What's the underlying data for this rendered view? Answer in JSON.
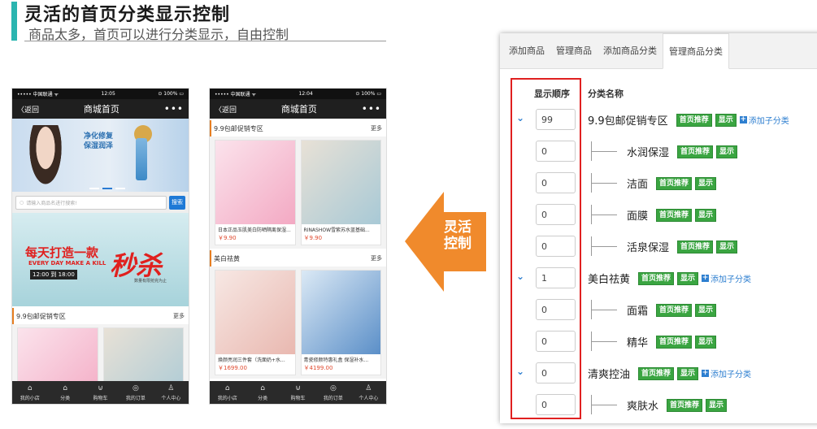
{
  "header": {
    "title": "灵活的首页分类显示控制",
    "subtitle": "商品太多，首页可以进行分类显示，自由控制"
  },
  "arrow": {
    "line1": "灵活",
    "line2": "控制",
    "color": "#f08a2c"
  },
  "phone1": {
    "status": {
      "carrier": "••••• 中国联通 ᯤ",
      "time": "12:05",
      "battery": "⊙ 100% ▭"
    },
    "nav": {
      "back": "〈返回",
      "title": "商城首页",
      "more": "•••"
    },
    "banner1": {
      "line1": "净化修复",
      "line2": "保湿润泽"
    },
    "search": {
      "placeholder": "请输入商品名进行搜索!",
      "button": "搜索"
    },
    "banner2": {
      "line1": "每天打造一款",
      "line2": "EVERY DAY MAKE A KILL",
      "timer": "12:00 到 18:00",
      "big": "秒杀",
      "note": "数量有限抢完为止"
    },
    "section": {
      "title": "9.9包邮促销专区",
      "more": "更多"
    },
    "tabs": [
      "我的小店",
      "分类",
      "购物车",
      "我的订单",
      "个人中心"
    ]
  },
  "phone2": {
    "status": {
      "carrier": "••••• 中国联通 ᯤ",
      "time": "12:04",
      "battery": "⊙ 100% ▭"
    },
    "nav": {
      "back": "〈返回",
      "title": "商城首页",
      "more": "•••"
    },
    "section1": {
      "title": "9.9包邮促销专区",
      "more": "更多",
      "products": [
        {
          "name": "日本正品玉肌美白防晒隔离保湿...",
          "price": "￥9.90"
        },
        {
          "name": "RINASHOW雪紫苏水蓝基础...",
          "price": "￥9.90"
        }
      ]
    },
    "section2": {
      "title": "美白祛黄",
      "more": "更多",
      "products": [
        {
          "name": "焕颜亮润三件套（洗面奶+水...",
          "price": "￥1699.00"
        },
        {
          "name": "青瓷修颜特惠礼盒 保湿补水...",
          "price": "￥4199.00"
        }
      ]
    },
    "tabs": [
      "我的小店",
      "分类",
      "购物车",
      "我的订单",
      "个人中心"
    ]
  },
  "admin": {
    "tabs": [
      "添加商品",
      "管理商品",
      "添加商品分类",
      "管理商品分类"
    ],
    "columns": {
      "order": "显示顺序",
      "name": "分类名称"
    },
    "badges": {
      "home": "首页推荐",
      "show": "显示"
    },
    "add_sub": "添加子分类",
    "rows": [
      {
        "order": "99",
        "name": "9.9包邮促销专区",
        "chevron": "⌄"
      },
      {
        "order": "0",
        "name": "水润保湿"
      },
      {
        "order": "0",
        "name": "洁面"
      },
      {
        "order": "0",
        "name": "面膜"
      },
      {
        "order": "0",
        "name": "活泉保湿"
      },
      {
        "order": "1",
        "name": "美白祛黄",
        "chevron": "⌄"
      },
      {
        "order": "0",
        "name": "面霜"
      },
      {
        "order": "0",
        "name": "精华"
      },
      {
        "order": "0",
        "name": "清爽控油",
        "chevron": "⌄"
      },
      {
        "order": "0",
        "name": "爽肤水"
      }
    ]
  }
}
